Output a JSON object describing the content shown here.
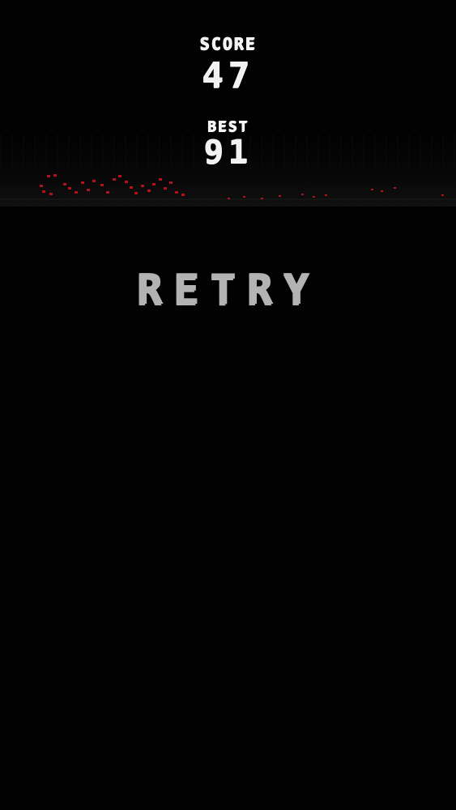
{
  "hud": {
    "score_label": "SCORE",
    "score_value": "47",
    "best_label": "BEST",
    "best_value": "91"
  },
  "actions": {
    "retry_label": "RETRY"
  },
  "colors": {
    "background": "#020202",
    "hud_text": "#f2f2f2",
    "retry_text": "#b3b3b3",
    "particles": "#b3121b"
  }
}
